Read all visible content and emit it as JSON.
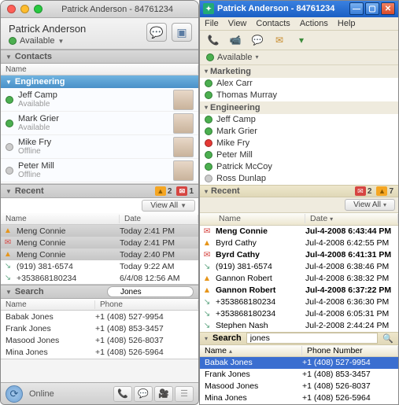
{
  "left": {
    "title": "Patrick Anderson - 84761234",
    "user_name": "Patrick Anderson",
    "availability": "Available",
    "contacts": {
      "section": "Contacts",
      "col_name": "Name",
      "group": "Engineering",
      "items": [
        {
          "name": "Jeff Camp",
          "status": "Available",
          "presence": "av"
        },
        {
          "name": "Mark Grier",
          "status": "Available",
          "presence": "av"
        },
        {
          "name": "Mike Fry",
          "status": "Offline",
          "presence": "off"
        },
        {
          "name": "Peter Mill",
          "status": "Offline",
          "presence": "off"
        }
      ]
    },
    "recent": {
      "section": "Recent",
      "warn_count": "2",
      "mail_count": "1",
      "view_all": "View All",
      "col_name": "Name",
      "col_date": "Date",
      "items": [
        {
          "icon": "warn",
          "name": "Meng Connie",
          "date": "Today 2:41 PM",
          "sel": true
        },
        {
          "icon": "env",
          "name": "Meng Connie",
          "date": "Today 2:41 PM",
          "sel": true
        },
        {
          "icon": "warn",
          "name": "Meng Connie",
          "date": "Today 2:40 PM",
          "sel": true
        },
        {
          "icon": "ph",
          "name": "(919) 381-6574",
          "date": "Today 9:22 AM",
          "sel": false
        },
        {
          "icon": "ph",
          "name": "+353868180234",
          "date": "6/4/08 12:56 AM",
          "sel": false
        }
      ]
    },
    "search": {
      "section": "Search",
      "query": "Jones",
      "col_name": "Name",
      "col_phone": "Phone",
      "items": [
        {
          "name": "Babak Jones",
          "phone": "+1 (408) 527-9954"
        },
        {
          "name": "Frank Jones",
          "phone": "+1 (408) 853-3457"
        },
        {
          "name": "Masood Jones",
          "phone": "+1 (408) 526-8037"
        },
        {
          "name": "Mina Jones",
          "phone": "+1 (408) 526-5964"
        }
      ]
    },
    "footer_status": "Online"
  },
  "right": {
    "title": "Patrick Anderson - 84761234",
    "menus": [
      "File",
      "View",
      "Contacts",
      "Actions",
      "Help"
    ],
    "availability": "Available",
    "groups": [
      {
        "label": "Marketing",
        "items": [
          {
            "name": "Alex Carr",
            "presence": "av"
          },
          {
            "name": "Thomas Murray",
            "presence": "av"
          }
        ]
      },
      {
        "label": "Engineering",
        "items": [
          {
            "name": "Jeff Camp",
            "presence": "av"
          },
          {
            "name": "Mark Grier",
            "presence": "av"
          },
          {
            "name": "Mike Fry",
            "presence": "bz"
          },
          {
            "name": "Peter Mill",
            "presence": "av"
          },
          {
            "name": "Patrick McCoy",
            "presence": "av"
          },
          {
            "name": "Ross Dunlap",
            "presence": "off"
          }
        ]
      }
    ],
    "recent": {
      "section": "Recent",
      "mail_count": "2",
      "warn_count": "7",
      "view_all": "View All",
      "col_name": "Name",
      "col_date": "Date",
      "items": [
        {
          "icon": "env",
          "bold": true,
          "name": "Meng Connie",
          "date": "Jul-4-2008 6:43:44 PM"
        },
        {
          "icon": "warn",
          "bold": false,
          "name": "Byrd Cathy",
          "date": "Jul-4-2008 6:42:55 PM"
        },
        {
          "icon": "env",
          "bold": true,
          "name": "Byrd Cathy",
          "date": "Jul-4-2008 6:41:31 PM"
        },
        {
          "icon": "ph",
          "bold": false,
          "name": "(919) 381-6574",
          "date": "Jul-4-2008 6:38:46 PM"
        },
        {
          "icon": "warn",
          "bold": false,
          "name": "Gannon Robert",
          "date": "Jul-4-2008 6:38:32 PM"
        },
        {
          "icon": "warn",
          "bold": true,
          "name": "Gannon Robert",
          "date": "Jul-4-2008 6:37:22 PM"
        },
        {
          "icon": "ph",
          "bold": false,
          "name": "+353868180234",
          "date": "Jul-4-2008 6:36:30 PM"
        },
        {
          "icon": "ph",
          "bold": false,
          "name": "+353868180234",
          "date": "Jul-4-2008 6:05:31 PM"
        },
        {
          "icon": "ph",
          "bold": false,
          "name": "Stephen Nash",
          "date": "Jul-2-2008 2:44:24 PM"
        }
      ]
    },
    "search": {
      "section": "Search",
      "query": "jones",
      "col_name": "Name",
      "col_phone": "Phone Number",
      "items": [
        {
          "name": "Babak Jones",
          "phone": "+1 (408) 527-9954",
          "sel": true
        },
        {
          "name": "Frank Jones",
          "phone": "+1 (408) 853-3457",
          "sel": false
        },
        {
          "name": "Masood Jones",
          "phone": "+1 (408) 526-8037",
          "sel": false
        },
        {
          "name": "Mina Jones",
          "phone": "+1 (408) 526-5964",
          "sel": false
        }
      ]
    }
  }
}
